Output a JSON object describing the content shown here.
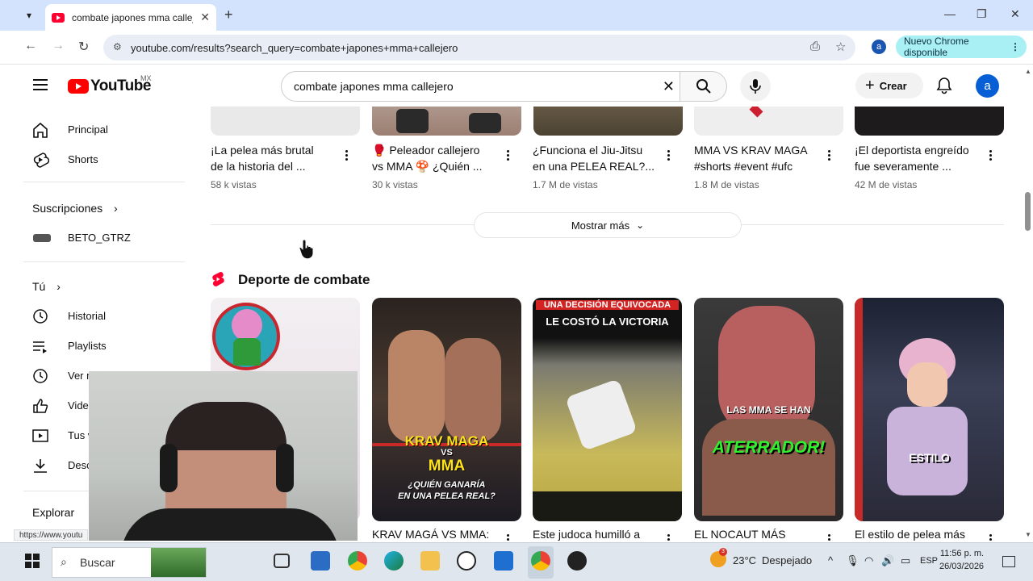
{
  "browser": {
    "tab_title": "combate japones mma callejero",
    "url": "youtube.com/results?search_query=combate+japones+mma+callejero",
    "profile_initial": "a",
    "update_label": "Nuevo Chrome disponible"
  },
  "youtube": {
    "logo_text": "YouTube",
    "country": "MX",
    "search_value": "combate japones mma callejero",
    "create_label": "Crear",
    "avatar_initial": "a"
  },
  "sidebar": {
    "items": [
      {
        "label": "Principal",
        "icon": "home-icon"
      },
      {
        "label": "Shorts",
        "icon": "shorts-icon"
      }
    ],
    "subs_header": "Suscripciones",
    "subscription": "BETO_GTRZ",
    "you_header": "Tú",
    "you_items": [
      {
        "label": "Historial",
        "icon": "history-icon"
      },
      {
        "label": "Playlists",
        "icon": "playlist-icon"
      },
      {
        "label": "Ver m",
        "icon": "clock-icon"
      },
      {
        "label": "Vide",
        "icon": "thumb-up-icon"
      },
      {
        "label": "Tus v",
        "icon": "video-icon"
      },
      {
        "label": "Desc",
        "icon": "download-icon"
      }
    ],
    "explore_header": "Explorar"
  },
  "videos": [
    {
      "title1": "¡La pelea más brutal",
      "title2": "de la historia del ...",
      "views": "58 k vistas"
    },
    {
      "title1": "🥊 Peleador callejero",
      "title2": "vs MMA 🍄 ¿Quién ...",
      "views": "30 k vistas"
    },
    {
      "title1": "¿Funciona el Jiu-Jitsu",
      "title2": "en una PELEA REAL?...",
      "views": "1.7 M de vistas"
    },
    {
      "title1": "MMA VS KRAV MAGA",
      "title2": "#shorts  #event #ufc",
      "views": "1.8 M de vistas"
    },
    {
      "title1": "¡El deportista engreído",
      "title2": "fue severamente ...",
      "views": "42 M de vistas"
    }
  ],
  "show_more": "Mostrar más",
  "shorts_section": {
    "title": "Deporte de combate",
    "items": [
      {
        "title": "",
        "overlay": ""
      },
      {
        "title": "KRAV MAGÁ VS MMA:",
        "overlay1": "KRAV MAGA",
        "overlay2": "VS",
        "overlay3": "MMA",
        "overlay4": "¿QUIÉN GANARÍA",
        "overlay5": "EN UNA PELEA REAL?"
      },
      {
        "title": "Este judoca humilló a",
        "overlay1": "UNA DECISIÓN EQUIVOCADA",
        "overlay2": "LE COSTÓ LA VICTORIA"
      },
      {
        "title": "EL NOCAUT MÁS",
        "overlay1": "LAS MMA SE HAN",
        "overlay2": "ATERRADOR!"
      },
      {
        "title": "El estilo de pelea más",
        "overlay1": "ESTILO"
      }
    ]
  },
  "status_url": "https://www.youtu",
  "taskbar": {
    "search_placeholder": "Buscar",
    "temperature": "23°C",
    "weather": "Despejado",
    "weather_badge": "3",
    "language": "ESP",
    "time": "11:56 p. m.",
    "date": "26/03/2026"
  }
}
